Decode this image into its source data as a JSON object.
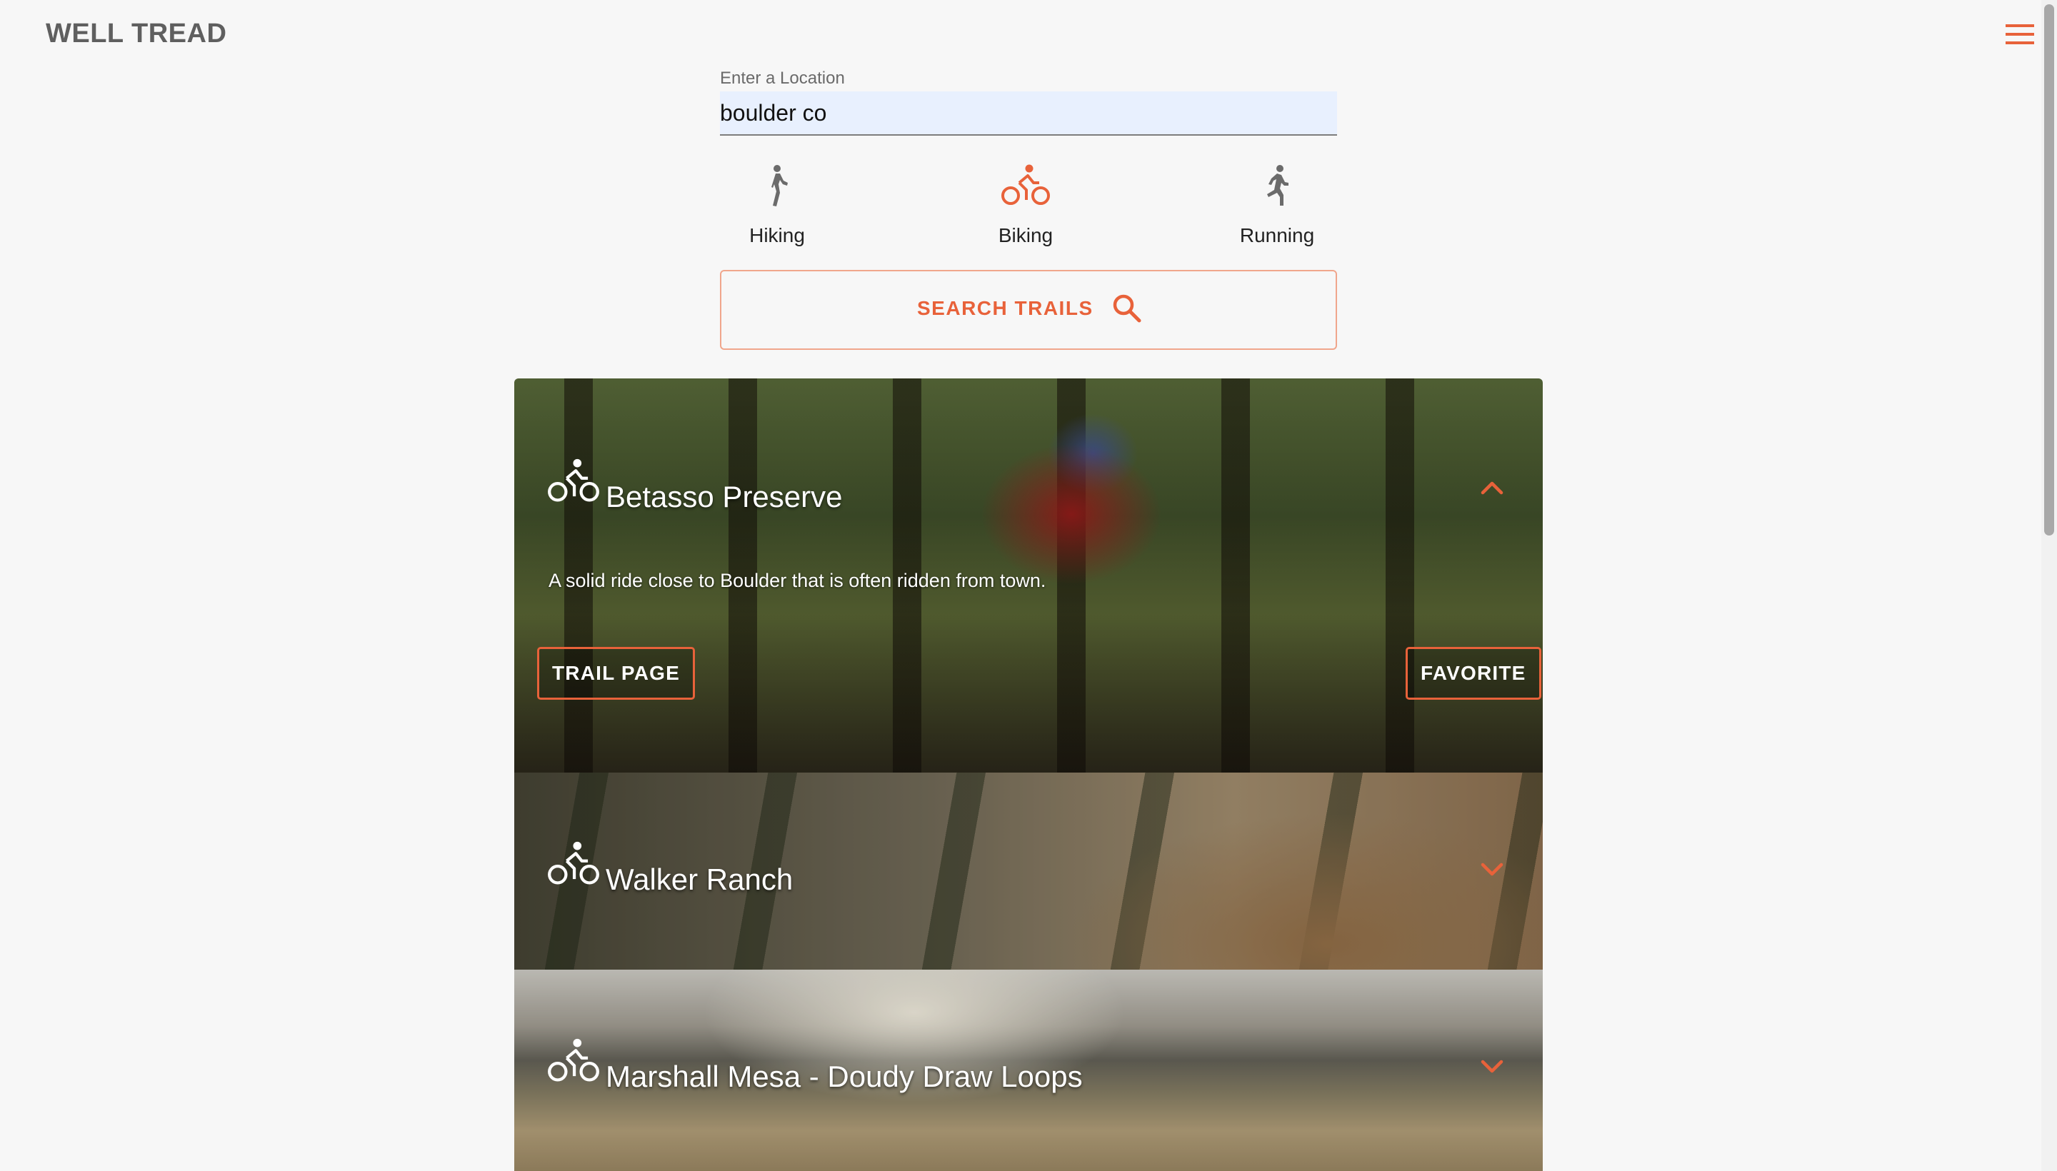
{
  "header": {
    "brand": "WELL TREAD",
    "menu_icon": "hamburger-menu-icon",
    "accent_color": "#e8623a"
  },
  "search": {
    "location_label": "Enter a Location",
    "location_value": "boulder co",
    "activities": [
      {
        "label": "Hiking",
        "icon": "hiking-icon",
        "selected": false
      },
      {
        "label": "Biking",
        "icon": "biking-icon",
        "selected": true
      },
      {
        "label": "Running",
        "icon": "running-icon",
        "selected": false
      }
    ],
    "search_button_label": "SEARCH TRAILS",
    "search_icon": "search-icon"
  },
  "trails": [
    {
      "name": "Betasso Preserve",
      "icon": "biking-icon",
      "expanded": true,
      "description": "A solid ride close to Boulder that is often ridden from town.",
      "trail_page_label": "TRAIL PAGE",
      "favorite_label": "FAVORITE"
    },
    {
      "name": "Walker Ranch",
      "icon": "biking-icon",
      "expanded": false
    },
    {
      "name": "Marshall Mesa - Doudy Draw Loops",
      "icon": "biking-icon",
      "expanded": false
    }
  ]
}
